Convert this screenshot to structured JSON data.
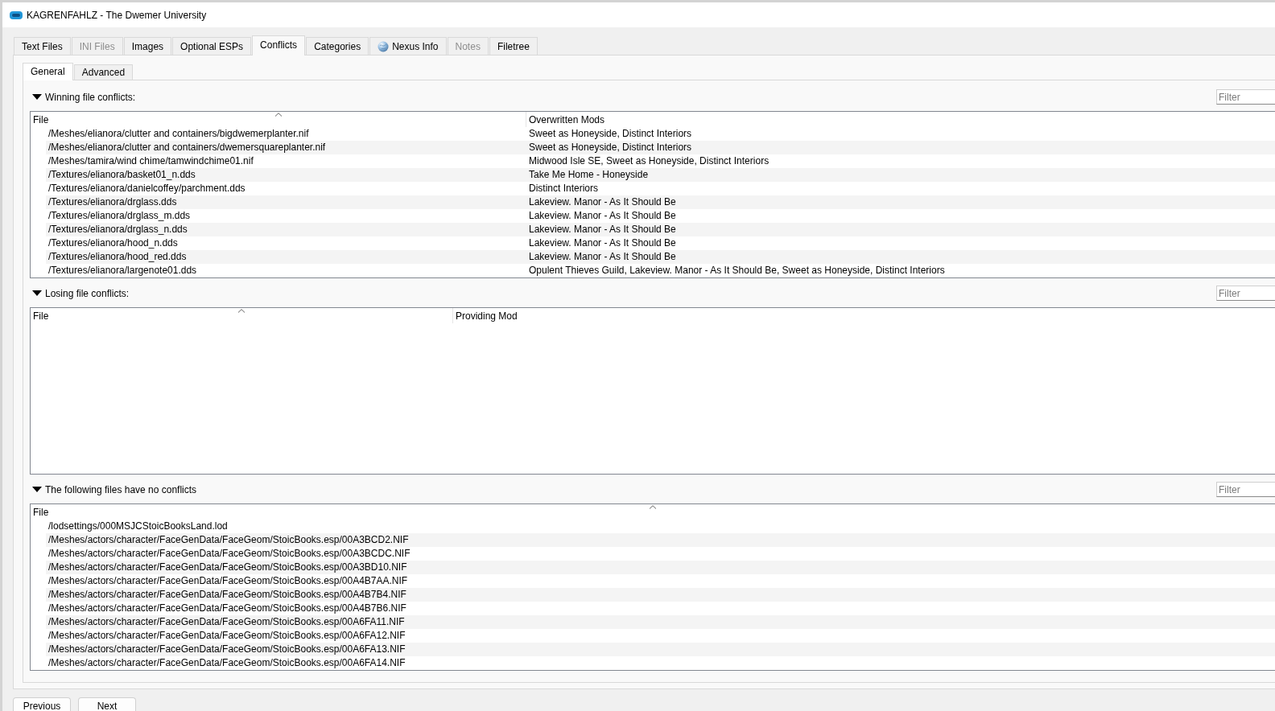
{
  "window": {
    "title": "KAGRENFAHLZ - The Dwemer University"
  },
  "tabs": [
    {
      "label": "Text Files",
      "selected": false,
      "disabled": false,
      "kind": "text"
    },
    {
      "label": "INI Files",
      "selected": false,
      "disabled": true,
      "kind": "text"
    },
    {
      "label": "Images",
      "selected": false,
      "disabled": false,
      "kind": "text"
    },
    {
      "label": "Optional ESPs",
      "selected": false,
      "disabled": false,
      "kind": "text"
    },
    {
      "label": "Conflicts",
      "selected": true,
      "disabled": false,
      "kind": "text"
    },
    {
      "label": "Categories",
      "selected": false,
      "disabled": false,
      "kind": "text"
    },
    {
      "label": "Nexus Info",
      "selected": false,
      "disabled": false,
      "kind": "icon"
    },
    {
      "label": "Notes",
      "selected": false,
      "disabled": true,
      "kind": "text"
    },
    {
      "label": "Filetree",
      "selected": false,
      "disabled": false,
      "kind": "text"
    }
  ],
  "subtabs": [
    {
      "label": "General",
      "selected": true
    },
    {
      "label": "Advanced",
      "selected": false
    }
  ],
  "sections": [
    {
      "title": "Winning file conflicts:",
      "expanded": true,
      "filter": {
        "placeholder": "Filter"
      },
      "table": {
        "columns": [
          {
            "label": "File",
            "sorted": true
          },
          {
            "label": "Overwritten Mods",
            "sorted": false
          }
        ],
        "rows": [
          [
            "/Meshes/elianora/clutter and containers/bigdwemerplanter.nif",
            "Sweet as Honeyside, Distinct Interiors"
          ],
          [
            "/Meshes/elianora/clutter and containers/dwemersquareplanter.nif",
            "Sweet as Honeyside, Distinct Interiors"
          ],
          [
            "/Meshes/tamira/wind chime/tamwindchime01.nif",
            "Midwood Isle SE, Sweet as Honeyside, Distinct Interiors"
          ],
          [
            "/Textures/elianora/basket01_n.dds",
            "Take Me Home - Honeyside"
          ],
          [
            "/Textures/elianora/danielcoffey/parchment.dds",
            "Distinct Interiors"
          ],
          [
            "/Textures/elianora/drglass.dds",
            "Lakeview. Manor - As It Should Be"
          ],
          [
            "/Textures/elianora/drglass_m.dds",
            "Lakeview. Manor - As It Should Be"
          ],
          [
            "/Textures/elianora/drglass_n.dds",
            "Lakeview. Manor - As It Should Be"
          ],
          [
            "/Textures/elianora/hood_n.dds",
            "Lakeview. Manor - As It Should Be"
          ],
          [
            "/Textures/elianora/hood_red.dds",
            "Lakeview. Manor - As It Should Be"
          ],
          [
            "/Textures/elianora/largenote01.dds",
            "Opulent Thieves Guild, Lakeview. Manor - As It Should Be, Sweet as Honeyside, Distinct Interiors"
          ]
        ]
      }
    },
    {
      "title": "Losing file conflicts:",
      "expanded": true,
      "filter": {
        "placeholder": "Filter"
      },
      "table": {
        "columns": [
          {
            "label": "File",
            "sorted": true
          },
          {
            "label": "Providing Mod",
            "sorted": false
          }
        ]
      }
    },
    {
      "title": "The following files have no conflicts",
      "expanded": true,
      "filter": {
        "placeholder": "Filter"
      },
      "table": {
        "columns": [
          {
            "label": "File",
            "sorted": true
          }
        ],
        "rows": [
          [
            "/lodsettings/000MSJCStoicBooksLand.lod"
          ],
          [
            "/Meshes/actors/character/FaceGenData/FaceGeom/StoicBooks.esp/00A3BCD2.NIF"
          ],
          [
            "/Meshes/actors/character/FaceGenData/FaceGeom/StoicBooks.esp/00A3BCDC.NIF"
          ],
          [
            "/Meshes/actors/character/FaceGenData/FaceGeom/StoicBooks.esp/00A3BD10.NIF"
          ],
          [
            "/Meshes/actors/character/FaceGenData/FaceGeom/StoicBooks.esp/00A4B7AA.NIF"
          ],
          [
            "/Meshes/actors/character/FaceGenData/FaceGeom/StoicBooks.esp/00A4B7B4.NIF"
          ],
          [
            "/Meshes/actors/character/FaceGenData/FaceGeom/StoicBooks.esp/00A4B7B6.NIF"
          ],
          [
            "/Meshes/actors/character/FaceGenData/FaceGeom/StoicBooks.esp/00A6FA11.NIF"
          ],
          [
            "/Meshes/actors/character/FaceGenData/FaceGeom/StoicBooks.esp/00A6FA12.NIF"
          ],
          [
            "/Meshes/actors/character/FaceGenData/FaceGeom/StoicBooks.esp/00A6FA13.NIF"
          ],
          [
            "/Meshes/actors/character/FaceGenData/FaceGeom/StoicBooks.esp/00A6FA14.NIF"
          ]
        ]
      }
    }
  ],
  "buttons": [
    "Previous",
    "Next"
  ]
}
